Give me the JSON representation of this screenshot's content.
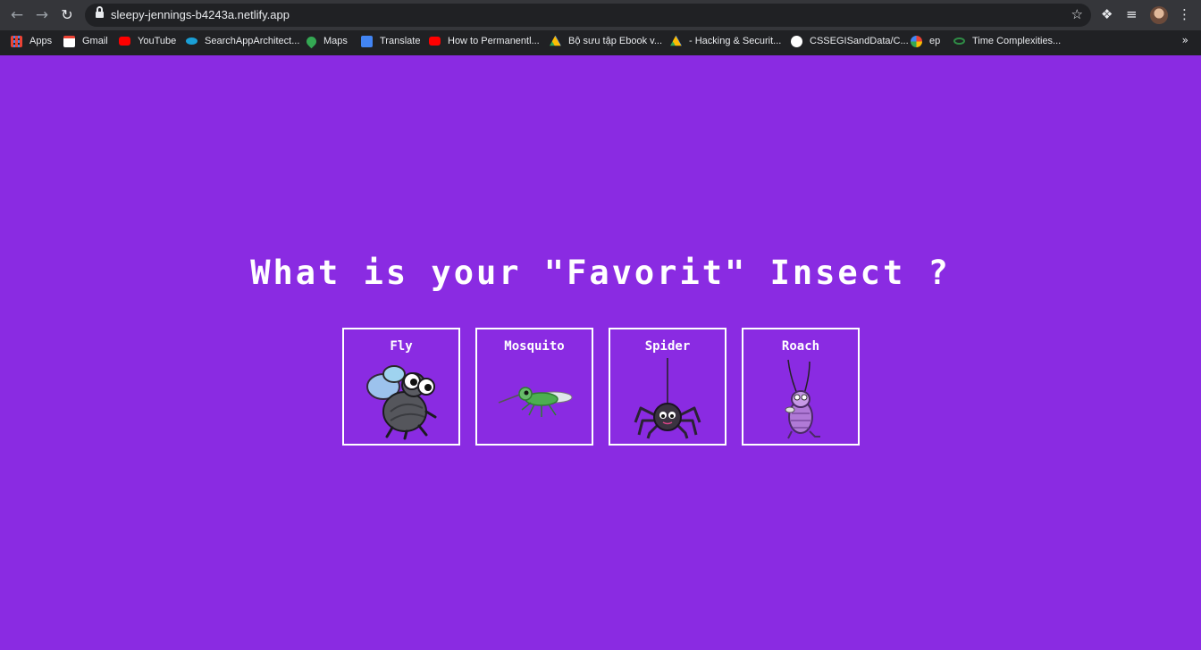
{
  "browser": {
    "url": "sleepy-jennings-b4243a.netlify.app",
    "bookmarks": [
      {
        "label": "Apps",
        "icon": "apps-grid-icon",
        "color": "#4285f4"
      },
      {
        "label": "Gmail",
        "icon": "gmail-icon",
        "color": "#ea4335"
      },
      {
        "label": "YouTube",
        "icon": "youtube-icon",
        "color": "#ff0000"
      },
      {
        "label": "SearchAppArchitect...",
        "icon": "site-icon",
        "color": "#1a9fd6"
      },
      {
        "label": "Maps",
        "icon": "maps-icon",
        "color": "#34a853"
      },
      {
        "label": "Translate",
        "icon": "translate-icon",
        "color": "#4285f4"
      },
      {
        "label": "How to Permanentl...",
        "icon": "youtube-icon",
        "color": "#ff0000"
      },
      {
        "label": "Bộ sưu tập Ebook v...",
        "icon": "drive-icon",
        "color": "#fbbc04"
      },
      {
        "label": "- Hacking & Securit...",
        "icon": "drive-icon",
        "color": "#fbbc04"
      },
      {
        "label": "CSSEGISandData/C...",
        "icon": "github-icon",
        "color": "#ffffff"
      },
      {
        "label": "ep",
        "icon": "google-icon",
        "color": "#ffffff"
      },
      {
        "label": "Time Complexities...",
        "icon": "gfg-icon",
        "color": "#2f8d46"
      }
    ]
  },
  "page": {
    "background": "#8a2be2",
    "heading": "What is your \"Favorit\" Insect ?",
    "insects": [
      {
        "label": "Fly",
        "icon": "fly-icon"
      },
      {
        "label": "Mosquito",
        "icon": "mosquito-icon"
      },
      {
        "label": "Spider",
        "icon": "spider-icon"
      },
      {
        "label": "Roach",
        "icon": "roach-icon"
      }
    ]
  }
}
